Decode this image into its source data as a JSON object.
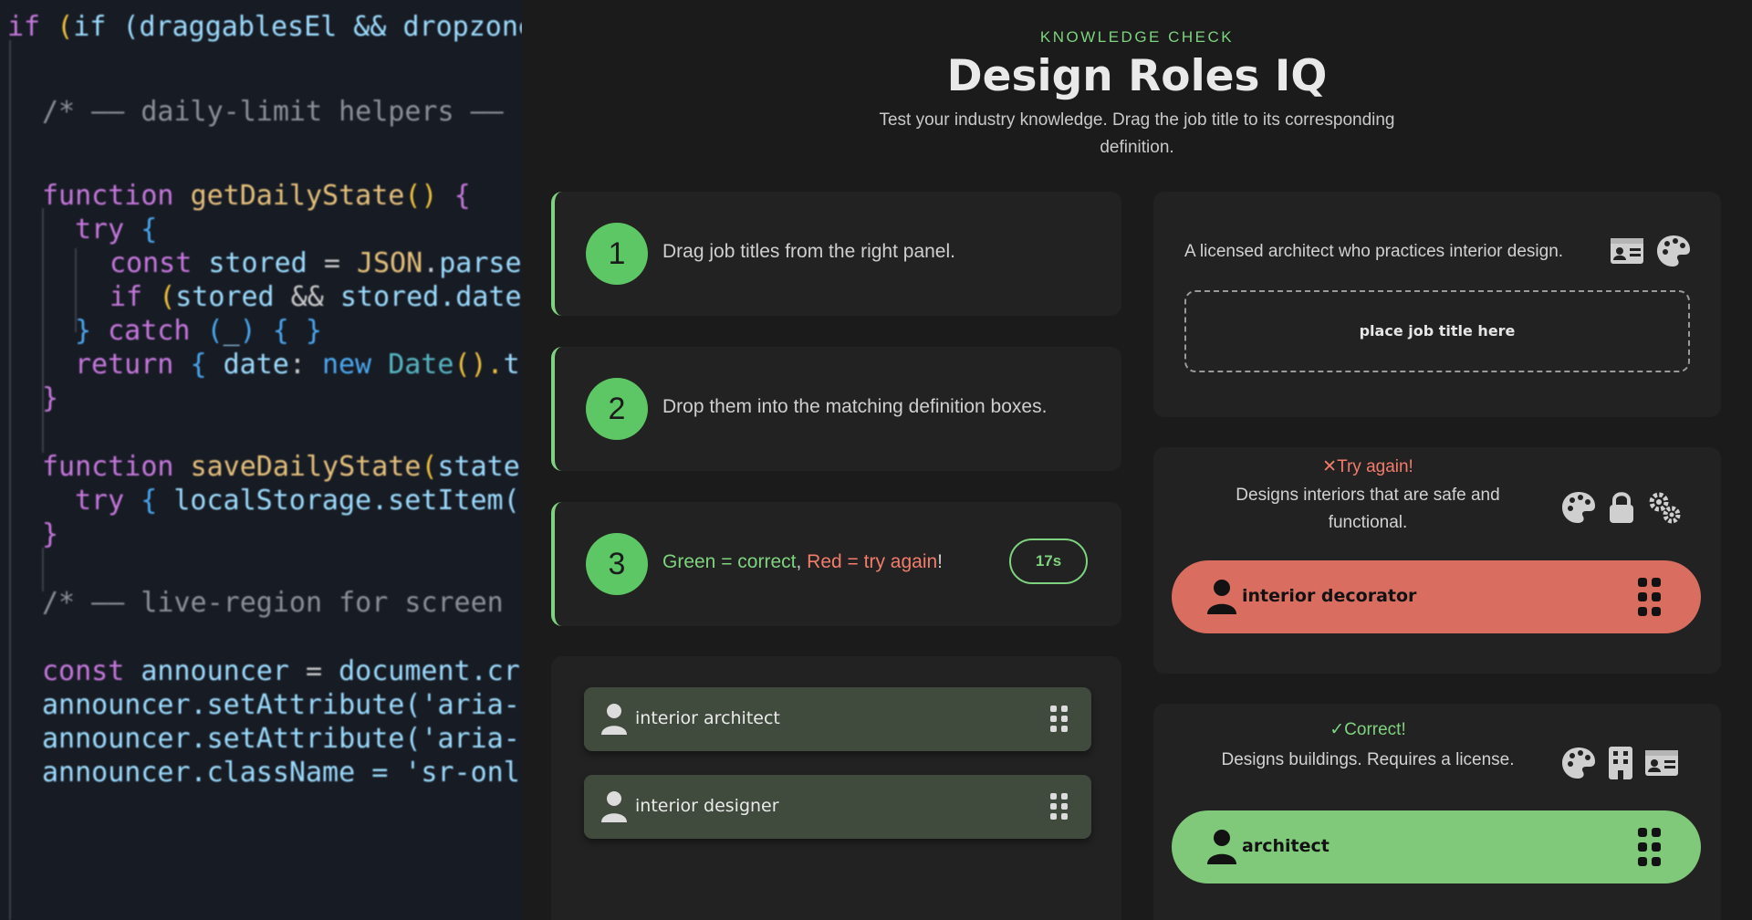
{
  "code": {
    "lines": [
      "if (draggablesEl && dropzonesEl",
      "/* —— daily-limit helpers ——",
      "function getDailyState() {",
      "try {",
      "const stored = JSON.parse",
      "if (stored && stored.date",
      "} catch (_) { }",
      "return { date: new Date().t",
      "}",
      "function saveDailyState(state",
      "try { localStorage.setItem(",
      "}",
      "/* —— live-region for screen",
      "const announcer = document.cr",
      "announcer.setAttribute('aria-",
      "announcer.setAttribute('aria-",
      "announcer.className = 'sr-onl"
    ]
  },
  "header": {
    "eyebrow": "KNOWLEDGE CHECK",
    "title": "Design Roles IQ",
    "subtitle": "Test your industry knowledge. Drag the job title to its corresponding definition."
  },
  "steps": [
    {
      "number": "1",
      "text": "Drag job titles from the right panel."
    },
    {
      "number": "2",
      "text": "Drop them into the matching definition boxes."
    },
    {
      "number": "3",
      "green_text": "Green = correct",
      "separator": ", ",
      "red_text": "Red = try again",
      "end": "!"
    }
  ],
  "timer": "17s",
  "bank": [
    {
      "label": "interior architect",
      "icon": "person-icon"
    },
    {
      "label": "interior designer",
      "icon": "person-icon"
    }
  ],
  "cards": [
    {
      "definition": "A licensed architect who practices interior design.",
      "icons": [
        "id-card-icon",
        "palette-icon"
      ],
      "placeholder": "place job title here"
    },
    {
      "status": "Try again!",
      "status_icon": "✕",
      "definition": "Designs interiors that are safe and functional.",
      "icons": [
        "palette-icon",
        "lock-icon",
        "gears-icon"
      ],
      "answer": "interior decorator"
    },
    {
      "status": "Correct!",
      "status_icon": "✓",
      "definition": "Designs buildings. Requires a license.",
      "icons": [
        "palette-icon",
        "building-icon",
        "id-card-icon"
      ],
      "answer": "architect"
    }
  ],
  "colors": {
    "accent_green": "#7ed37f",
    "step_circle": "#5dc765",
    "wrong_red": "#f27c6b",
    "wrong_pill": "#d96e60",
    "correct_pill": "#80c97b",
    "chip_bg": "#404a3d",
    "card_bg": "#222222",
    "page_bg": "#1b1b1b"
  }
}
